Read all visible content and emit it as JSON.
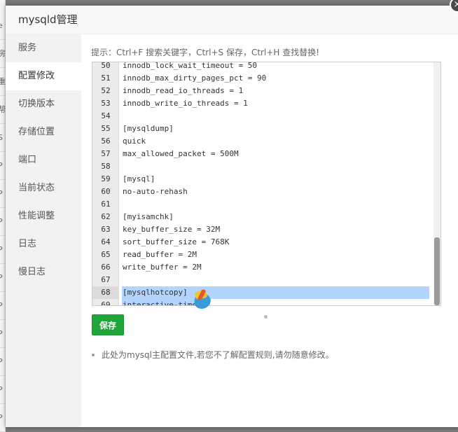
{
  "modal": {
    "title": "mysqld管理",
    "close_icon": "×"
  },
  "background_rows": [
    "e",
    "房",
    "重",
    "帮",
    "S",
    "P",
    "P",
    "P",
    "P",
    "P",
    "P",
    "P",
    "P",
    "P",
    "P"
  ],
  "sidebar": {
    "items": [
      {
        "label": "服务"
      },
      {
        "label": "配置修改"
      },
      {
        "label": "切换版本"
      },
      {
        "label": "存储位置"
      },
      {
        "label": "端口"
      },
      {
        "label": "当前状态"
      },
      {
        "label": "性能调整"
      },
      {
        "label": "日志"
      },
      {
        "label": "慢日志"
      }
    ],
    "active_index": 1
  },
  "editor": {
    "hint": "提示：Ctrl+F 搜索关键字，Ctrl+S 保存，Ctrl+H 查找替换!",
    "lines": [
      {
        "num": "51",
        "text": "innodb_max_dirty_pages_pct = 90"
      },
      {
        "num": "52",
        "text": "innodb_read_io_threads = 1"
      },
      {
        "num": "53",
        "text": "innodb_write_io_threads = 1"
      },
      {
        "num": "54",
        "text": ""
      },
      {
        "num": "55",
        "text": "[mysqldump]"
      },
      {
        "num": "56",
        "text": "quick"
      },
      {
        "num": "57",
        "text": "max_allowed_packet = 500M"
      },
      {
        "num": "58",
        "text": ""
      },
      {
        "num": "59",
        "text": "[mysql]"
      },
      {
        "num": "60",
        "text": "no-auto-rehash"
      },
      {
        "num": "61",
        "text": ""
      },
      {
        "num": "62",
        "text": "[myisamchk]"
      },
      {
        "num": "63",
        "text": "key_buffer_size = 32M"
      },
      {
        "num": "64",
        "text": "sort_buffer_size = 768K"
      },
      {
        "num": "65",
        "text": "read_buffer = 2M"
      },
      {
        "num": "66",
        "text": "write_buffer = 2M"
      },
      {
        "num": "67",
        "text": ""
      },
      {
        "num": "68",
        "text": "[mysqlhotcopy]"
      },
      {
        "num": "69",
        "text": "interactive-timeout"
      }
    ],
    "cut_top_line": "innodb_lock_wait_timeout = 50"
  },
  "save_button": {
    "label": "保存"
  },
  "note": {
    "text": "此处为mysql主配置文件,若您不了解配置规则,请勿随意修改。"
  },
  "colors": {
    "accent": "#20a53a",
    "selection": "#b3d4fc"
  }
}
